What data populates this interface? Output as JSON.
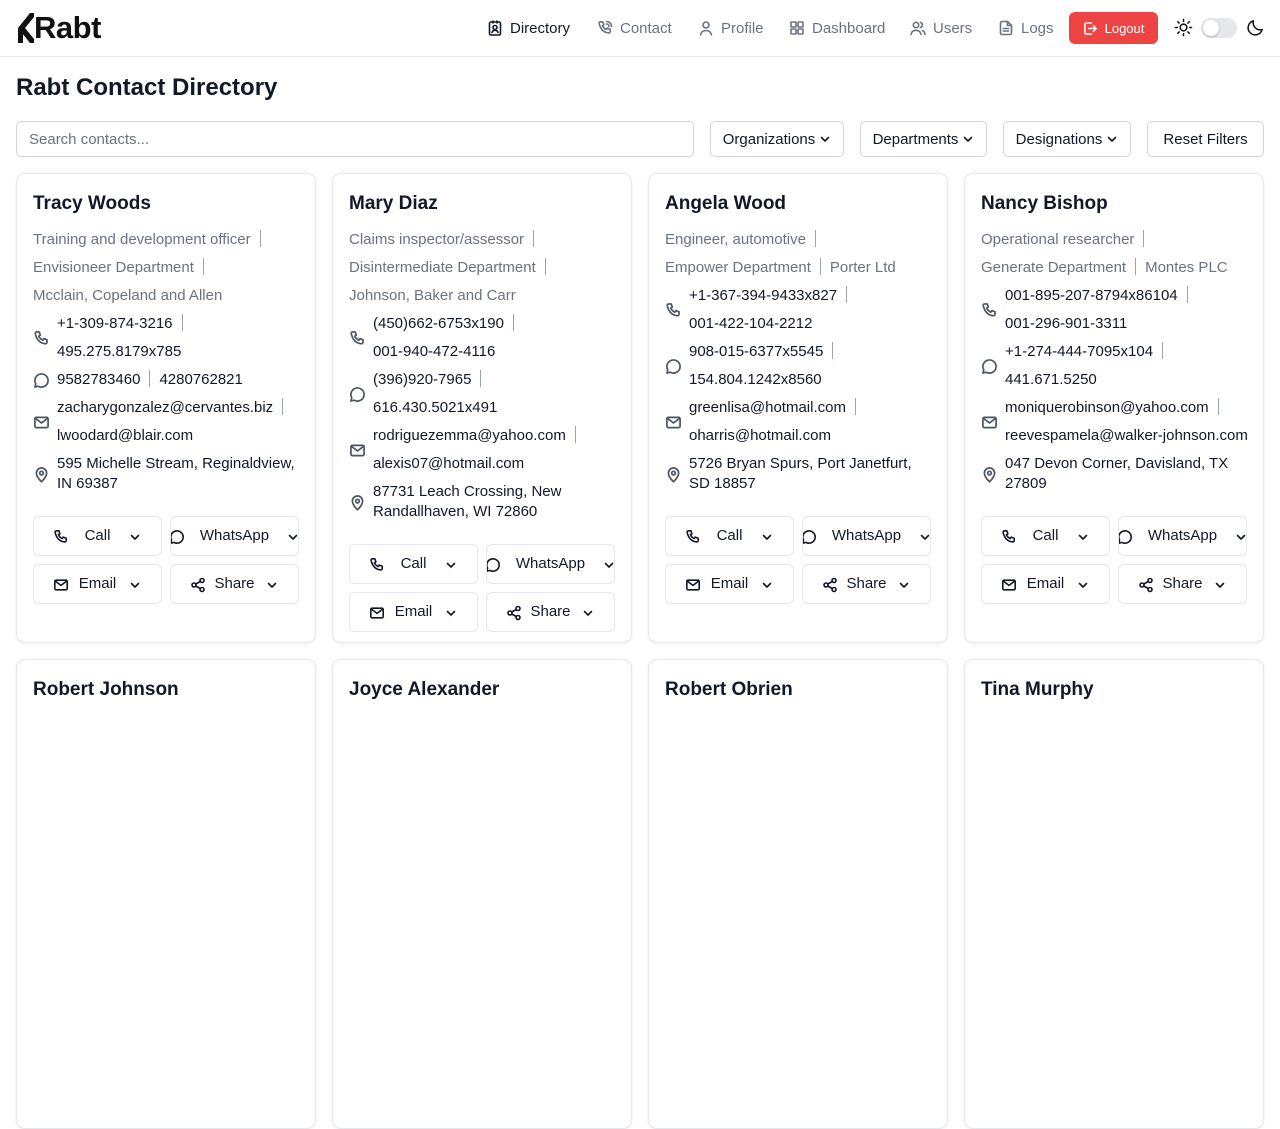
{
  "app": {
    "logo_text": "Rabt"
  },
  "nav": [
    {
      "label": "Directory",
      "icon": "contact-card-icon",
      "active": true
    },
    {
      "label": "Contact",
      "icon": "phone-icon"
    },
    {
      "label": "Profile",
      "icon": "user-icon"
    },
    {
      "label": "Dashboard",
      "icon": "grid-icon"
    },
    {
      "label": "Users",
      "icon": "users-icon"
    },
    {
      "label": "Logs",
      "icon": "file-text-icon"
    }
  ],
  "logout_label": "Logout",
  "theme": {
    "dark_mode": false
  },
  "colors": {
    "logout": "#ef4444",
    "text": "#111827",
    "muted": "#6b7280"
  },
  "page_title": "Rabt Contact Directory",
  "search": {
    "placeholder": "Search contacts...",
    "value": ""
  },
  "filters": {
    "organizations": "Organizations",
    "departments": "Departments",
    "designations": "Designations",
    "reset": "Reset Filters"
  },
  "actions": {
    "call": "Call",
    "whatsapp": "WhatsApp",
    "email": "Email",
    "share": "Share"
  },
  "contacts": [
    {
      "name": "Tracy Woods",
      "info_lines": [
        [
          "Training and development officer"
        ],
        [
          "Envisioneer Department"
        ],
        [
          "Mcclain, Copeland and Allen"
        ]
      ],
      "phones": [
        [
          "+1-309-874-3216"
        ],
        [
          "495.275.8179x785"
        ]
      ],
      "whatsapp": [
        [
          "9582783460",
          "4280762821"
        ]
      ],
      "emails": [
        [
          "zacharygonzalez@cervantes.biz"
        ],
        [
          "lwoodard@blair.com"
        ]
      ],
      "address": [
        "595 Michelle Stream, Reginaldview,",
        "IN 69387"
      ]
    },
    {
      "name": "Mary Diaz",
      "info_lines": [
        [
          "Claims inspector/assessor"
        ],
        [
          "Disintermediate Department"
        ],
        [
          "Johnson, Baker and Carr"
        ]
      ],
      "phones": [
        [
          "(450)662-6753x190"
        ],
        [
          "001-940-472-4116"
        ]
      ],
      "whatsapp": [
        [
          "(396)920-7965"
        ],
        [
          "616.430.5021x491"
        ]
      ],
      "emails": [
        [
          "rodriguezemma@yahoo.com"
        ],
        [
          "alexis07@hotmail.com"
        ]
      ],
      "address": [
        "87731 Leach Crossing, New",
        "Randallhaven, WI 72860"
      ]
    },
    {
      "name": "Angela Wood",
      "info_lines": [
        [
          "Engineer, automotive"
        ],
        [
          "Empower Department",
          "Porter Ltd"
        ]
      ],
      "phones": [
        [
          "+1-367-394-9433x827"
        ],
        [
          "001-422-104-2212"
        ]
      ],
      "whatsapp": [
        [
          "908-015-6377x5545"
        ],
        [
          "154.804.1242x8560"
        ]
      ],
      "emails": [
        [
          "greenlisa@hotmail.com"
        ],
        [
          "oharris@hotmail.com"
        ]
      ],
      "address": [
        "5726 Bryan Spurs, Port Janetfurt,",
        "SD 18857"
      ]
    },
    {
      "name": "Nancy Bishop",
      "info_lines": [
        [
          "Operational researcher"
        ],
        [
          "Generate Department",
          "Montes PLC"
        ]
      ],
      "phones": [
        [
          "001-895-207-8794x86104"
        ],
        [
          "001-296-901-3311"
        ]
      ],
      "whatsapp": [
        [
          "+1-274-444-7095x104"
        ],
        [
          "441.671.5250"
        ]
      ],
      "emails": [
        [
          "moniquerobinson@yahoo.com"
        ],
        [
          "reevespamela@walker-johnson.com"
        ]
      ],
      "address": [
        "047 Devon Corner, Davisland, TX",
        "27809"
      ]
    },
    {
      "name": "Robert Johnson"
    },
    {
      "name": "Joyce Alexander"
    },
    {
      "name": "Robert Obrien"
    },
    {
      "name": "Tina Murphy"
    }
  ]
}
